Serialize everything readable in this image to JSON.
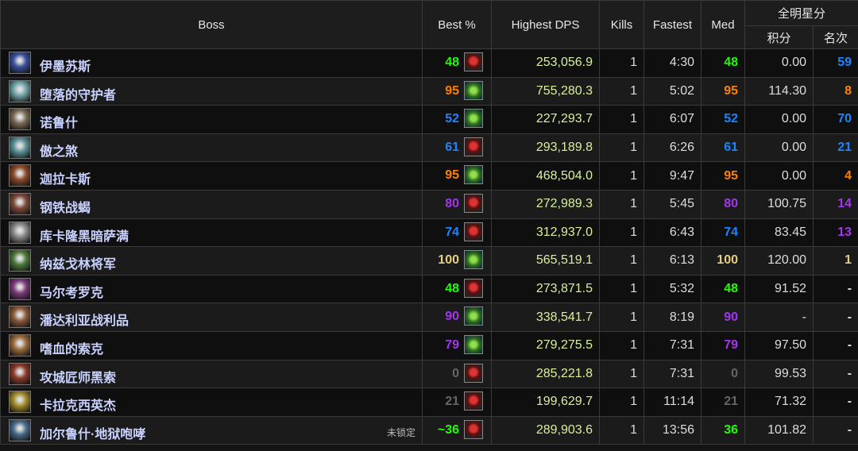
{
  "header": {
    "boss": "Boss",
    "best": "Best %",
    "dps": "Highest DPS",
    "kills": "Kills",
    "fastest": "Fastest",
    "med": "Med",
    "stars": "全明星分",
    "points": "积分",
    "rank": "名次"
  },
  "colors": {
    "green": "#1eff00",
    "blue": "#1b85ff",
    "purple": "#a335ee",
    "orange": "#ff8000",
    "gold": "#e5cc80",
    "gray": "#666666",
    "boss_name": "#c9d1ff",
    "dps": "#d8f09a"
  },
  "rows": [
    {
      "name": "伊墨苏斯",
      "note": "",
      "best": "48",
      "best_color": "green",
      "spec": "demon-face-icon",
      "dps": "253,056.9",
      "kills": "1",
      "fastest": "4:30",
      "med": "48",
      "med_color": "green",
      "points": "0.00",
      "rank": "59",
      "rank_color": "blue",
      "icon_color": "#3a4f9a"
    },
    {
      "name": "堕落的守护者",
      "note": "",
      "best": "95",
      "best_color": "orange",
      "spec": "fel-rune-icon",
      "dps": "755,280.3",
      "kills": "1",
      "fastest": "5:02",
      "med": "95",
      "med_color": "orange",
      "points": "114.30",
      "rank": "8",
      "rank_color": "orange",
      "icon_color": "#6fa4a6"
    },
    {
      "name": "诺鲁什",
      "note": "",
      "best": "52",
      "best_color": "blue",
      "spec": "fel-rune-icon",
      "dps": "227,293.7",
      "kills": "1",
      "fastest": "6:07",
      "med": "52",
      "med_color": "blue",
      "points": "0.00",
      "rank": "70",
      "rank_color": "blue",
      "icon_color": "#7b6a55"
    },
    {
      "name": "傲之煞",
      "note": "",
      "best": "61",
      "best_color": "blue",
      "spec": "demon-face-icon",
      "dps": "293,189.8",
      "kills": "1",
      "fastest": "6:26",
      "med": "61",
      "med_color": "blue",
      "points": "0.00",
      "rank": "21",
      "rank_color": "blue",
      "icon_color": "#5c8f96"
    },
    {
      "name": "迦拉卡斯",
      "note": "",
      "best": "95",
      "best_color": "orange",
      "spec": "fel-rune-icon",
      "dps": "468,504.0",
      "kills": "1",
      "fastest": "9:47",
      "med": "95",
      "med_color": "orange",
      "points": "0.00",
      "rank": "4",
      "rank_color": "orange",
      "icon_color": "#8a4a2a"
    },
    {
      "name": "钢铁战蝎",
      "note": "",
      "best": "80",
      "best_color": "purple",
      "spec": "demon-face-icon",
      "dps": "272,989.3",
      "kills": "1",
      "fastest": "5:45",
      "med": "80",
      "med_color": "purple",
      "points": "100.75",
      "rank": "14",
      "rank_color": "purple",
      "icon_color": "#7a4a3a"
    },
    {
      "name": "库卡隆黑暗萨满",
      "note": "",
      "best": "74",
      "best_color": "blue",
      "spec": "demon-face-icon",
      "dps": "312,937.0",
      "kills": "1",
      "fastest": "6:43",
      "med": "74",
      "med_color": "blue",
      "points": "83.45",
      "rank": "13",
      "rank_color": "purple",
      "icon_color": "#8a8a8a"
    },
    {
      "name": "纳兹戈林将军",
      "note": "",
      "best": "100",
      "best_color": "gold",
      "spec": "fel-rune-icon",
      "dps": "565,519.1",
      "kills": "1",
      "fastest": "6:13",
      "med": "100",
      "med_color": "gold",
      "points": "120.00",
      "rank": "1",
      "rank_color": "gold",
      "icon_color": "#4c7a3a"
    },
    {
      "name": "马尔考罗克",
      "note": "",
      "best": "48",
      "best_color": "green",
      "spec": "demon-face-icon",
      "dps": "273,871.5",
      "kills": "1",
      "fastest": "5:32",
      "med": "48",
      "med_color": "green",
      "points": "91.52",
      "rank": "-",
      "rank_color": "dash",
      "icon_color": "#7a3a7a"
    },
    {
      "name": "潘达利亚战利品",
      "note": "",
      "best": "90",
      "best_color": "purple",
      "spec": "fel-rune-icon",
      "dps": "338,541.7",
      "kills": "1",
      "fastest": "8:19",
      "med": "90",
      "med_color": "purple",
      "points": "-",
      "rank": "-",
      "rank_color": "dash",
      "icon_color": "#8a5a3a"
    },
    {
      "name": "嗜血的索克",
      "note": "",
      "best": "79",
      "best_color": "purple",
      "spec": "fel-rune-icon",
      "dps": "279,275.5",
      "kills": "1",
      "fastest": "7:31",
      "med": "79",
      "med_color": "purple",
      "points": "97.50",
      "rank": "-",
      "rank_color": "dash",
      "icon_color": "#9a6a3a"
    },
    {
      "name": "攻城匠师黑索",
      "note": "",
      "best": "0",
      "best_color": "gray",
      "spec": "demon-face-icon",
      "dps": "285,221.8",
      "kills": "1",
      "fastest": "7:31",
      "med": "0",
      "med_color": "gray",
      "points": "99.53",
      "rank": "-",
      "rank_color": "dash",
      "icon_color": "#8a3a2a"
    },
    {
      "name": "卡拉克西英杰",
      "note": "",
      "best": "21",
      "best_color": "gray",
      "spec": "demon-face-icon",
      "dps": "199,629.7",
      "kills": "1",
      "fastest": "11:14",
      "med": "21",
      "med_color": "gray",
      "points": "71.32",
      "rank": "-",
      "rank_color": "dash",
      "icon_color": "#a08a2a"
    },
    {
      "name": "加尔鲁什·地狱咆哮",
      "note": "未锁定",
      "best": "~36",
      "best_color": "green",
      "spec": "demon-face-icon",
      "dps": "289,903.6",
      "kills": "1",
      "fastest": "13:56",
      "med": "36",
      "med_color": "green",
      "points": "101.82",
      "rank": "-",
      "rank_color": "dash",
      "icon_color": "#4a6a8a"
    }
  ]
}
